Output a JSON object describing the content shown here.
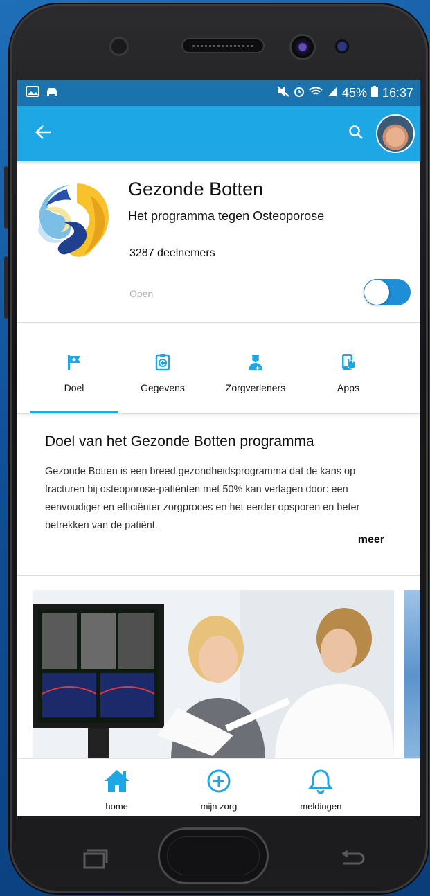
{
  "status_bar": {
    "battery": "45%",
    "time": "16:37"
  },
  "program": {
    "title": "Gezonde Botten",
    "subtitle": "Het programma tegen Osteoporose",
    "members": "3287 deelnemers",
    "open_label": "Open",
    "open_enabled": true
  },
  "tabs": [
    {
      "label": "Doel",
      "icon": "flag-icon"
    },
    {
      "label": "Gegevens",
      "icon": "clipboard-icon"
    },
    {
      "label": "Zorgverleners",
      "icon": "doctor-icon"
    },
    {
      "label": "Apps",
      "icon": "phone-touch-icon"
    }
  ],
  "goal": {
    "heading": "Doel van het Gezonde Botten programma",
    "body": "Gezonde Botten is een breed gezondheidsprogramma dat de kans op fracturen bij osteoporose-patiënten met 50% kan verlagen door: een eenvoudiger en efficiënter zorgproces en het eerder opsporen en beter betrekken van de patiënt.",
    "more": "meer"
  },
  "bottom_nav": [
    {
      "label": "home",
      "icon": "home-icon"
    },
    {
      "label": "mijn zorg",
      "icon": "plus-circle-icon"
    },
    {
      "label": "meldingen",
      "icon": "bell-icon"
    }
  ],
  "colors": {
    "accent": "#1ea7e5",
    "status_bar": "#1a73ad",
    "toggle_on": "#1e8fd6"
  }
}
